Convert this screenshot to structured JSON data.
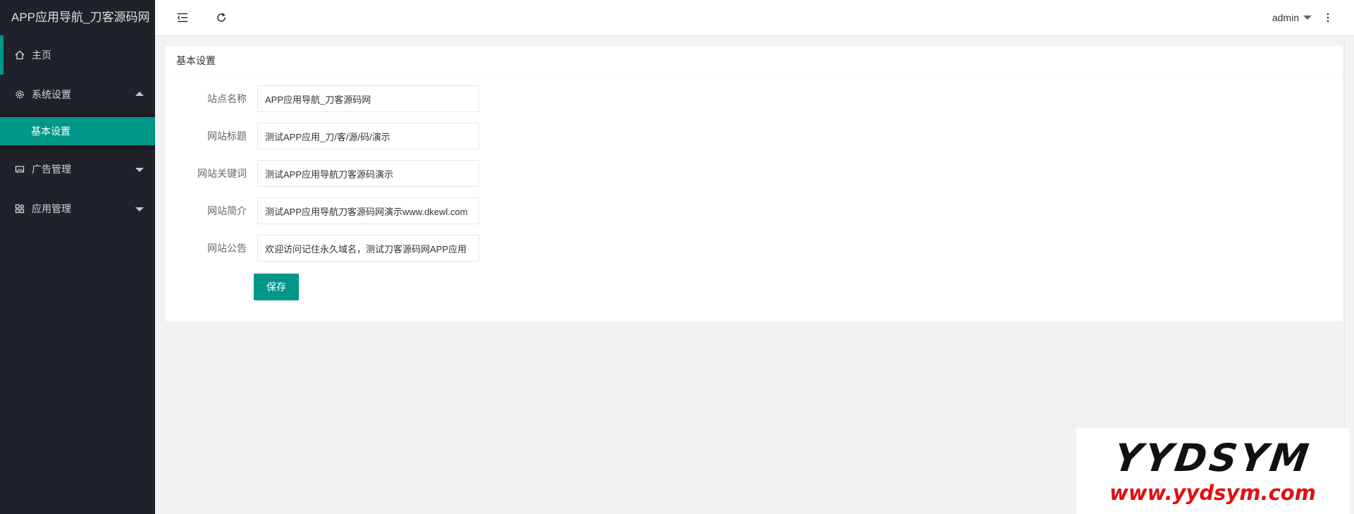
{
  "app": {
    "title": "APP应用导航_刀客源码网"
  },
  "sidebar": {
    "items": [
      {
        "label": "主页",
        "icon": "home-icon"
      },
      {
        "label": "系统设置",
        "icon": "gear-icon",
        "expanded": true,
        "children": [
          {
            "label": "基本设置",
            "selected": true
          }
        ]
      },
      {
        "label": "广告管理",
        "icon": "image-icon",
        "expanded": false
      },
      {
        "label": "应用管理",
        "icon": "apps-icon",
        "expanded": false
      }
    ]
  },
  "header": {
    "user": "admin",
    "icons": [
      "menu-shrink-icon",
      "refresh-icon",
      "more-vertical-icon"
    ]
  },
  "card": {
    "title": "基本设置",
    "fields": [
      {
        "label": "站点名称",
        "value": "APP应用导航_刀客源码网"
      },
      {
        "label": "网站标题",
        "value": "测试APP应用_刀/客/源/码/演示"
      },
      {
        "label": "网站关键词",
        "value": "测试APP应用导航刀客源码演示"
      },
      {
        "label": "网站简介",
        "value": "测试APP应用导航刀客源码网演示www.dkewl.com"
      },
      {
        "label": "网站公告",
        "value": "欢迎访问记住永久域名，测试刀客源码网APP应用"
      }
    ],
    "save_label": "保存"
  },
  "watermark": {
    "brand": "YYDSYM",
    "url": "www.yydsym.com"
  },
  "colors": {
    "accent": "#009688",
    "sidebar_bg": "#20222a",
    "watermark_url": "#e01010"
  }
}
